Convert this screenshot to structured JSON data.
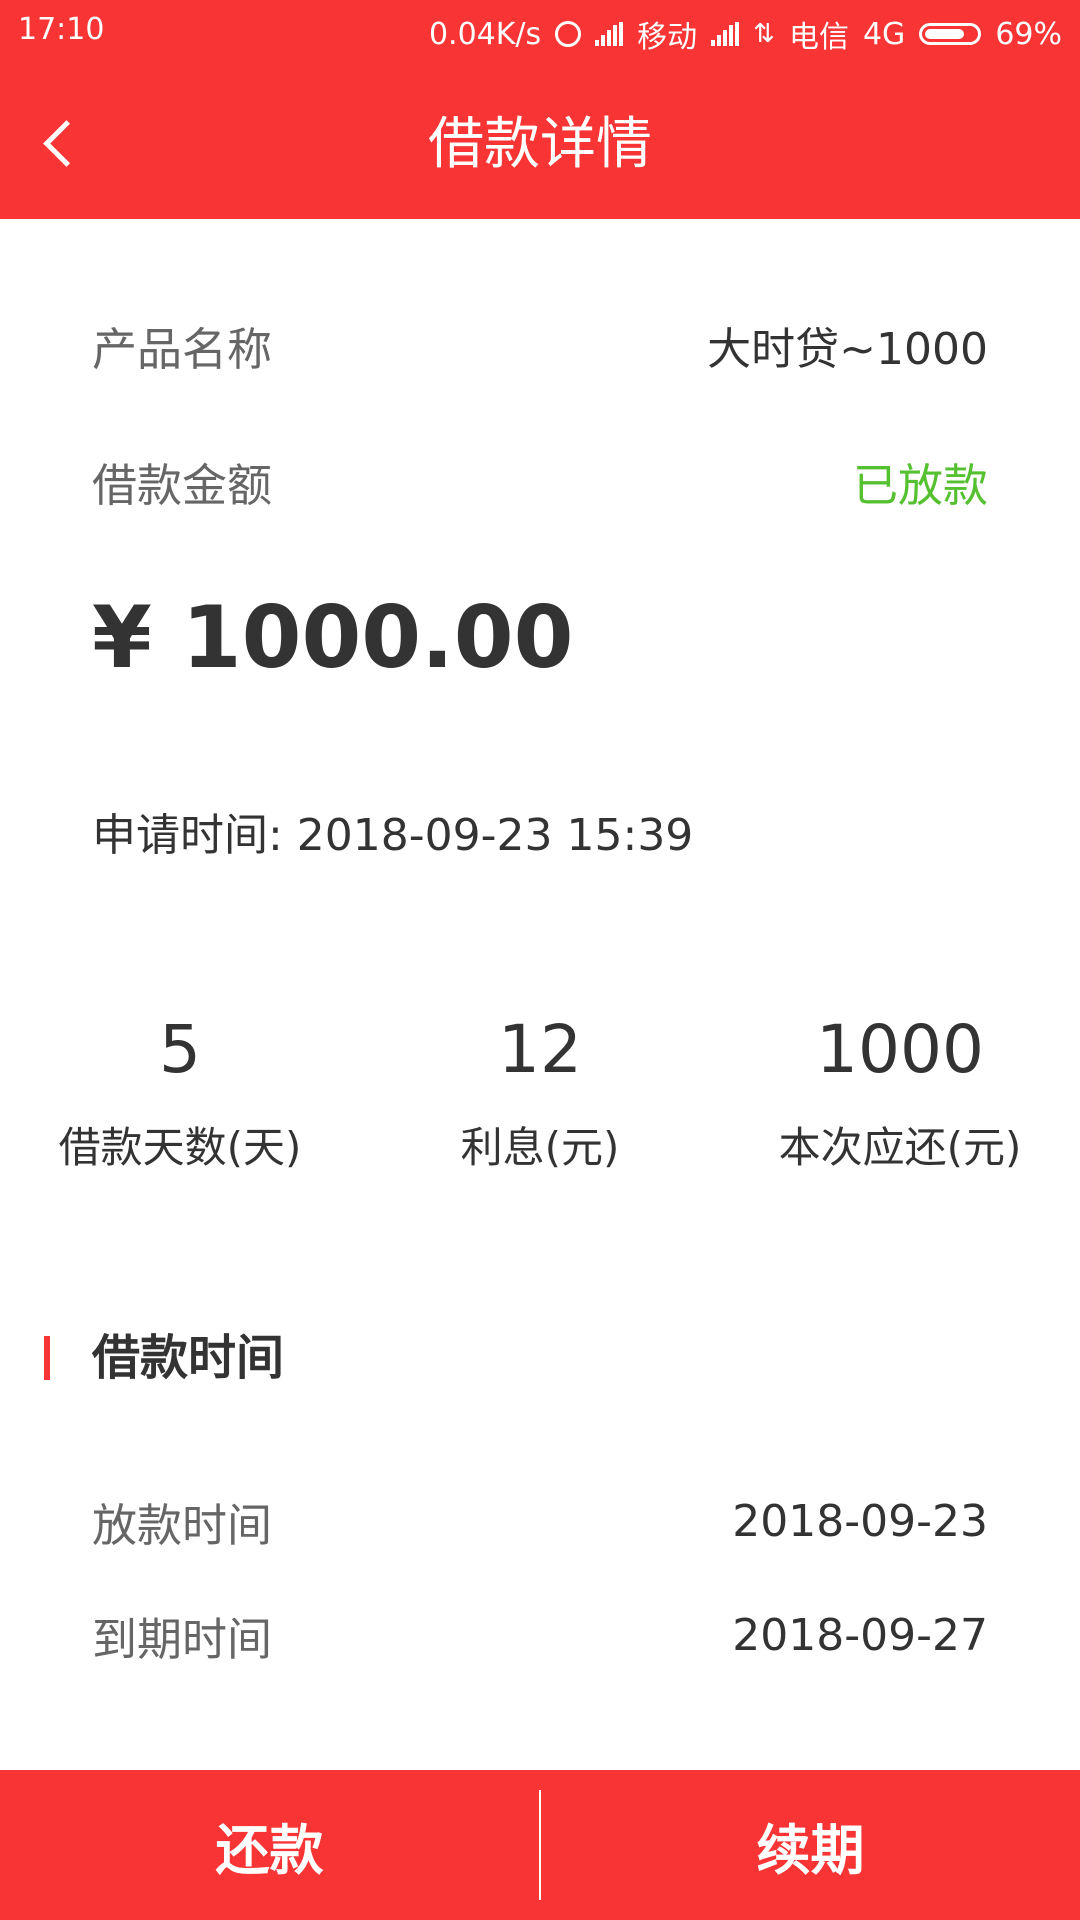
{
  "status_bar": {
    "time": "17:10",
    "speed": "0.04K/s",
    "carrier1": "移动",
    "carrier2": "电信",
    "network": "4G",
    "battery": "69%"
  },
  "header": {
    "title": "借款详情",
    "back_icon": "chevron-left-icon"
  },
  "product": {
    "label": "产品名称",
    "value": "大时贷~1000"
  },
  "loan": {
    "amount_label": "借款金额",
    "status": "已放款",
    "amount": "¥ 1000.00",
    "apply_time": "申请时间: 2018-09-23 15:39"
  },
  "stats": [
    {
      "value": "5",
      "label": "借款天数(天)"
    },
    {
      "value": "12",
      "label": "利息(元)"
    },
    {
      "value": "1000",
      "label": "本次应还(元)"
    }
  ],
  "section": {
    "title": "借款时间",
    "rows": [
      {
        "label": "放款时间",
        "value": "2018-09-23"
      },
      {
        "label": "到期时间",
        "value": "2018-09-27"
      }
    ]
  },
  "footer": {
    "repay_label": "还款",
    "renew_label": "续期"
  },
  "colors": {
    "accent": "#f83434",
    "status_green": "#56c130"
  }
}
